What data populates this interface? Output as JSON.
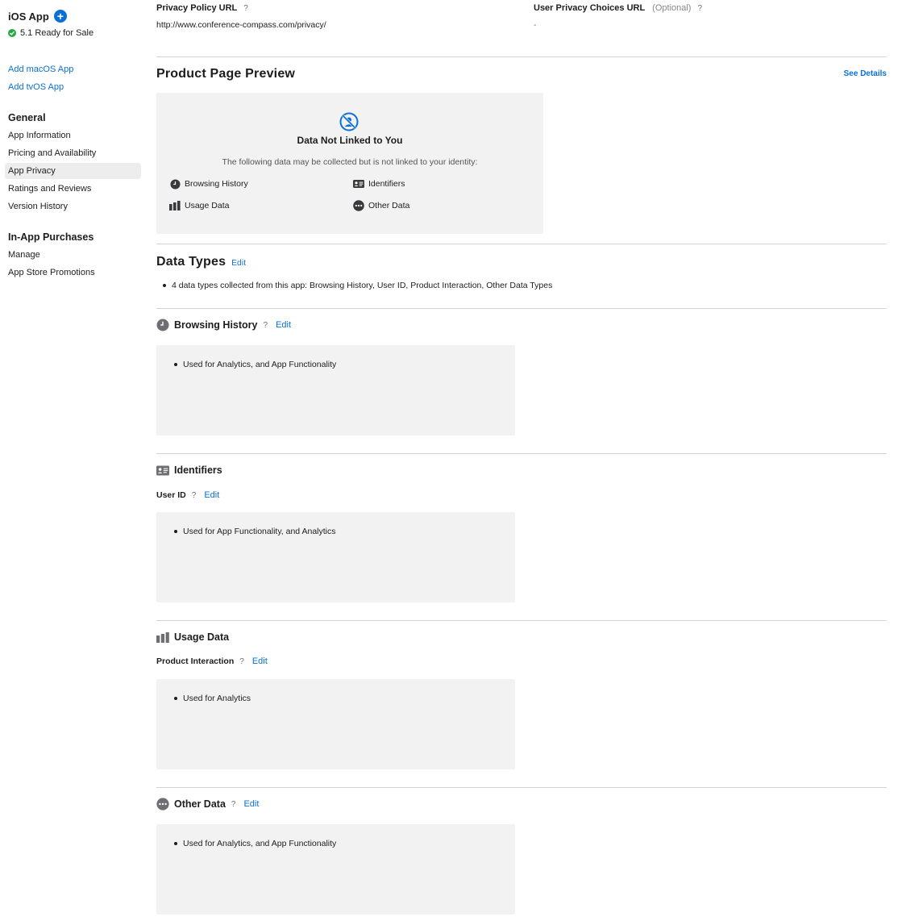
{
  "sidebar": {
    "app_title": "iOS App",
    "add_icon": "plus-circle-icon",
    "status": "5.1 Ready for Sale",
    "status_color": "#28a745",
    "links": [
      "Add macOS App",
      "Add tvOS App"
    ],
    "general_heading": "General",
    "general_items": [
      "App Information",
      "Pricing and Availability",
      "App Privacy",
      "Ratings and Reviews",
      "Version History"
    ],
    "active_item": "App Privacy",
    "iap_heading": "In-App Purchases",
    "iap_items": [
      "Manage",
      "App Store Promotions"
    ]
  },
  "urls": {
    "privacy_label": "Privacy Policy URL",
    "privacy_value": "http://www.conference-compass.com/privacy/",
    "choices_label": "User Privacy Choices URL",
    "choices_optional": "(Optional)",
    "choices_value": "-",
    "help": "?"
  },
  "preview": {
    "title": "Product Page Preview",
    "see_details": "See Details",
    "icon": "not-linked-icon",
    "box_title": "Data Not Linked to You",
    "box_subtitle": "The following data may be collected but is not linked to your identity:",
    "items": [
      {
        "label": "Browsing History",
        "icon": "clock-icon"
      },
      {
        "label": "Identifiers",
        "icon": "id-card-icon"
      },
      {
        "label": "Usage Data",
        "icon": "bar-chart-icon"
      },
      {
        "label": "Other Data",
        "icon": "ellipsis-icon"
      }
    ]
  },
  "data_types": {
    "title": "Data Types",
    "edit": "Edit",
    "summary": "4 data types collected from this app: Browsing History, User ID, Product Interaction, Other Data Types"
  },
  "categories": {
    "browsing": {
      "title": "Browsing History",
      "help": "?",
      "edit": "Edit",
      "usage": "Used for Analytics, and App Functionality"
    },
    "identifiers": {
      "title": "Identifiers",
      "sub": "User ID",
      "help": "?",
      "edit": "Edit",
      "usage": "Used for App Functionality, and Analytics"
    },
    "usage_data": {
      "title": "Usage Data",
      "sub": "Product Interaction",
      "help": "?",
      "edit": "Edit",
      "usage": "Used for Analytics"
    },
    "other": {
      "title": "Other Data",
      "help": "?",
      "edit": "Edit",
      "usage": "Used for Analytics, and App Functionality"
    }
  },
  "colors": {
    "accent": "#0a6fd6",
    "panel": "#f2f2f2",
    "divider": "#d2d2d7"
  }
}
